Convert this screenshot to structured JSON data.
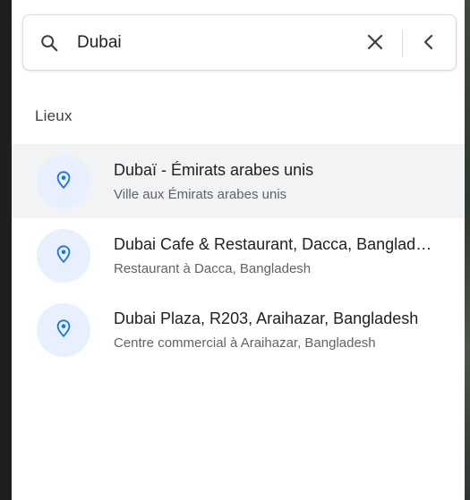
{
  "search": {
    "value": "Dubai",
    "clear_icon": "close-icon",
    "back_icon": "chevron-left-icon"
  },
  "section": {
    "title": "Lieux"
  },
  "results": [
    {
      "title": "Dubaï - Émirats arabes unis",
      "subtitle": "Ville aux Émirats arabes unis",
      "icon": "location-pin-icon",
      "highlighted": true
    },
    {
      "title": "Dubai Cafe & Restaurant, Dacca, Bangladesh",
      "subtitle": "Restaurant à Dacca, Bangladesh",
      "icon": "location-pin-icon",
      "highlighted": false
    },
    {
      "title": "Dubai Plaza, R203, Araihazar, Bangladesh",
      "subtitle": "Centre commercial à Araihazar, Bangladesh",
      "icon": "location-pin-icon",
      "highlighted": false
    }
  ],
  "colors": {
    "accent": "#1a73e8",
    "pin_background": "#e8f0fe",
    "highlight_row": "#f1f3f4"
  }
}
